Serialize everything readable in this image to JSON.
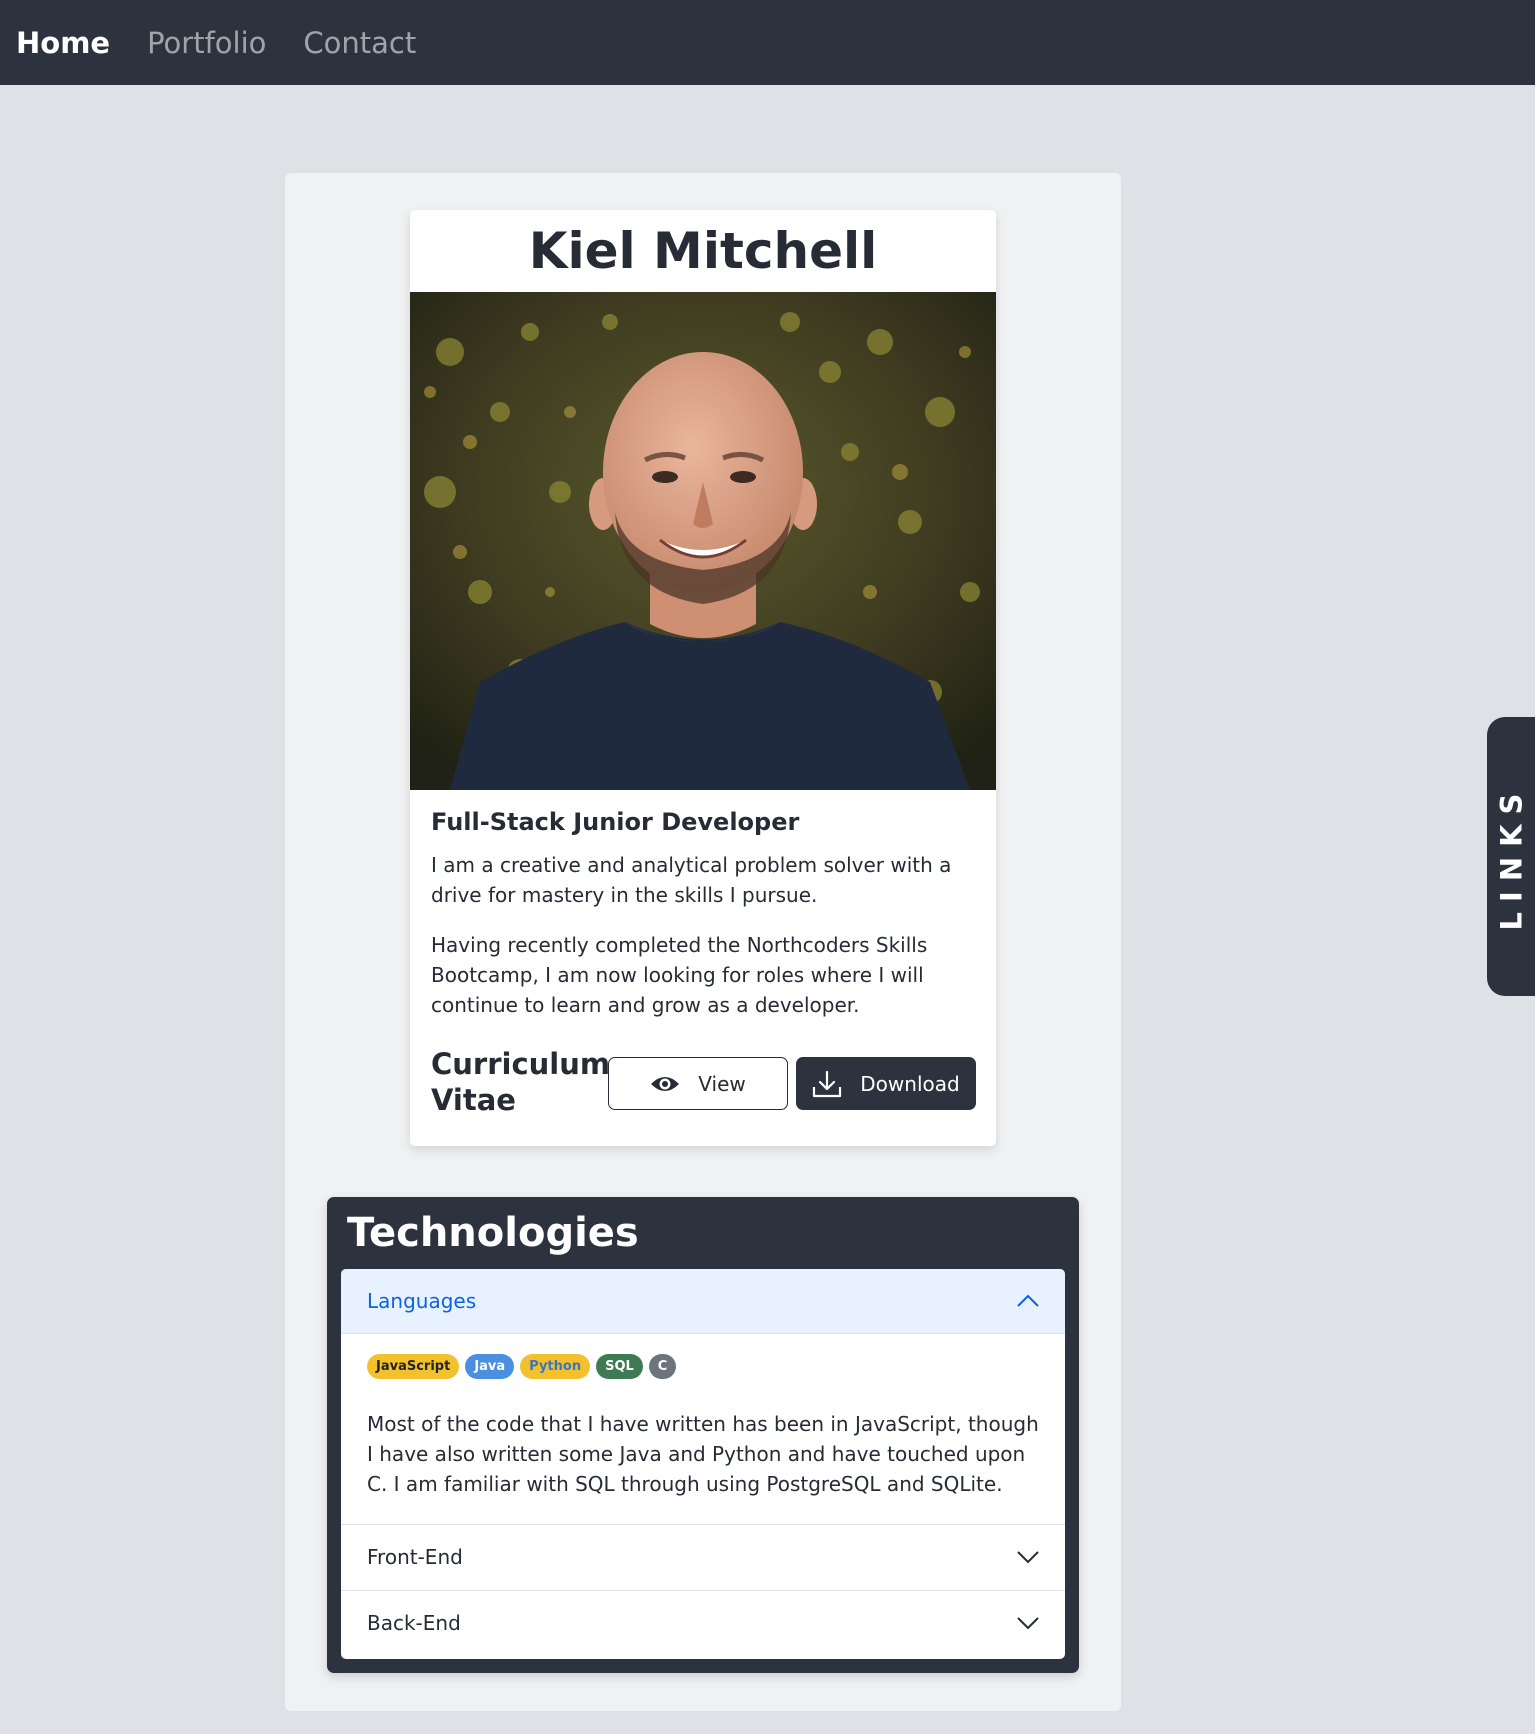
{
  "nav": {
    "items": [
      {
        "label": "Home"
      },
      {
        "label": "Portfolio"
      },
      {
        "label": "Contact"
      }
    ]
  },
  "profile": {
    "name": "Kiel Mitchell",
    "role": "Full-Stack Junior Developer",
    "bio_1": "I am a creative and analytical problem solver with a drive for mastery in the skills I pursue.",
    "bio_2": "Having recently completed the Northcoders Skills Bootcamp, I am now looking for roles where I will continue to learn and grow as a developer.",
    "cv_label": "Curriculum Vitae",
    "view_label": "View",
    "download_label": "Download"
  },
  "links_tab": {
    "label": "LINKS"
  },
  "technologies": {
    "title": "Technologies",
    "sections": [
      {
        "label": "Languages",
        "expanded": true,
        "badges": [
          {
            "label": "JavaScript",
            "bg": "#f3c12b",
            "fg": "#212529"
          },
          {
            "label": "Java",
            "bg": "#4a8fe0",
            "fg": "#ffffff"
          },
          {
            "label": "Python",
            "bg": "#f3c12b",
            "fg": "#3a76c4"
          },
          {
            "label": "SQL",
            "bg": "#3e7a52",
            "fg": "#ffffff"
          },
          {
            "label": "C",
            "bg": "#6c757d",
            "fg": "#ffffff"
          }
        ],
        "text": "Most of the code that I have written has been in JavaScript, though I have also written some Java and Python and have touched upon C. I am familiar with SQL through using PostgreSQL and SQLite."
      },
      {
        "label": "Front-End",
        "expanded": false
      },
      {
        "label": "Back-End",
        "expanded": false
      }
    ]
  },
  "colors": {
    "navbar": "#2d333e",
    "background": "#dee2e6",
    "accordion_active_bg": "#e7f1ff",
    "accordion_active_text": "#0c63e4"
  }
}
